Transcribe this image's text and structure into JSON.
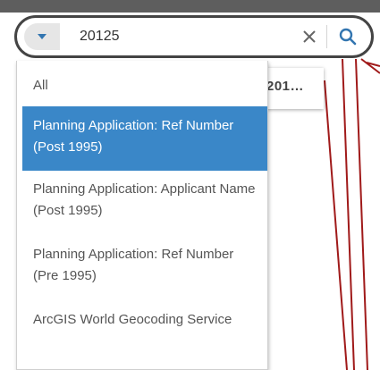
{
  "search": {
    "value": "20125",
    "clear_icon": "close-icon",
    "search_icon": "search-icon",
    "source_icon": "caret-down-icon"
  },
  "suggestion": {
    "text": "201…"
  },
  "dropdown": {
    "items": [
      {
        "label": "All"
      },
      {
        "label": "Planning Application: Ref Number (Post 1995)"
      },
      {
        "label": "Planning Application: Applicant Name (Post 1995)"
      },
      {
        "label": "Planning Application: Ref Number (Pre 1995)"
      },
      {
        "label": "ArcGIS World Geocoding Service"
      }
    ],
    "selected_index": 1
  },
  "colors": {
    "accent": "#3a87c8",
    "map_line": "#a01a1a",
    "border_dark": "#444444"
  }
}
